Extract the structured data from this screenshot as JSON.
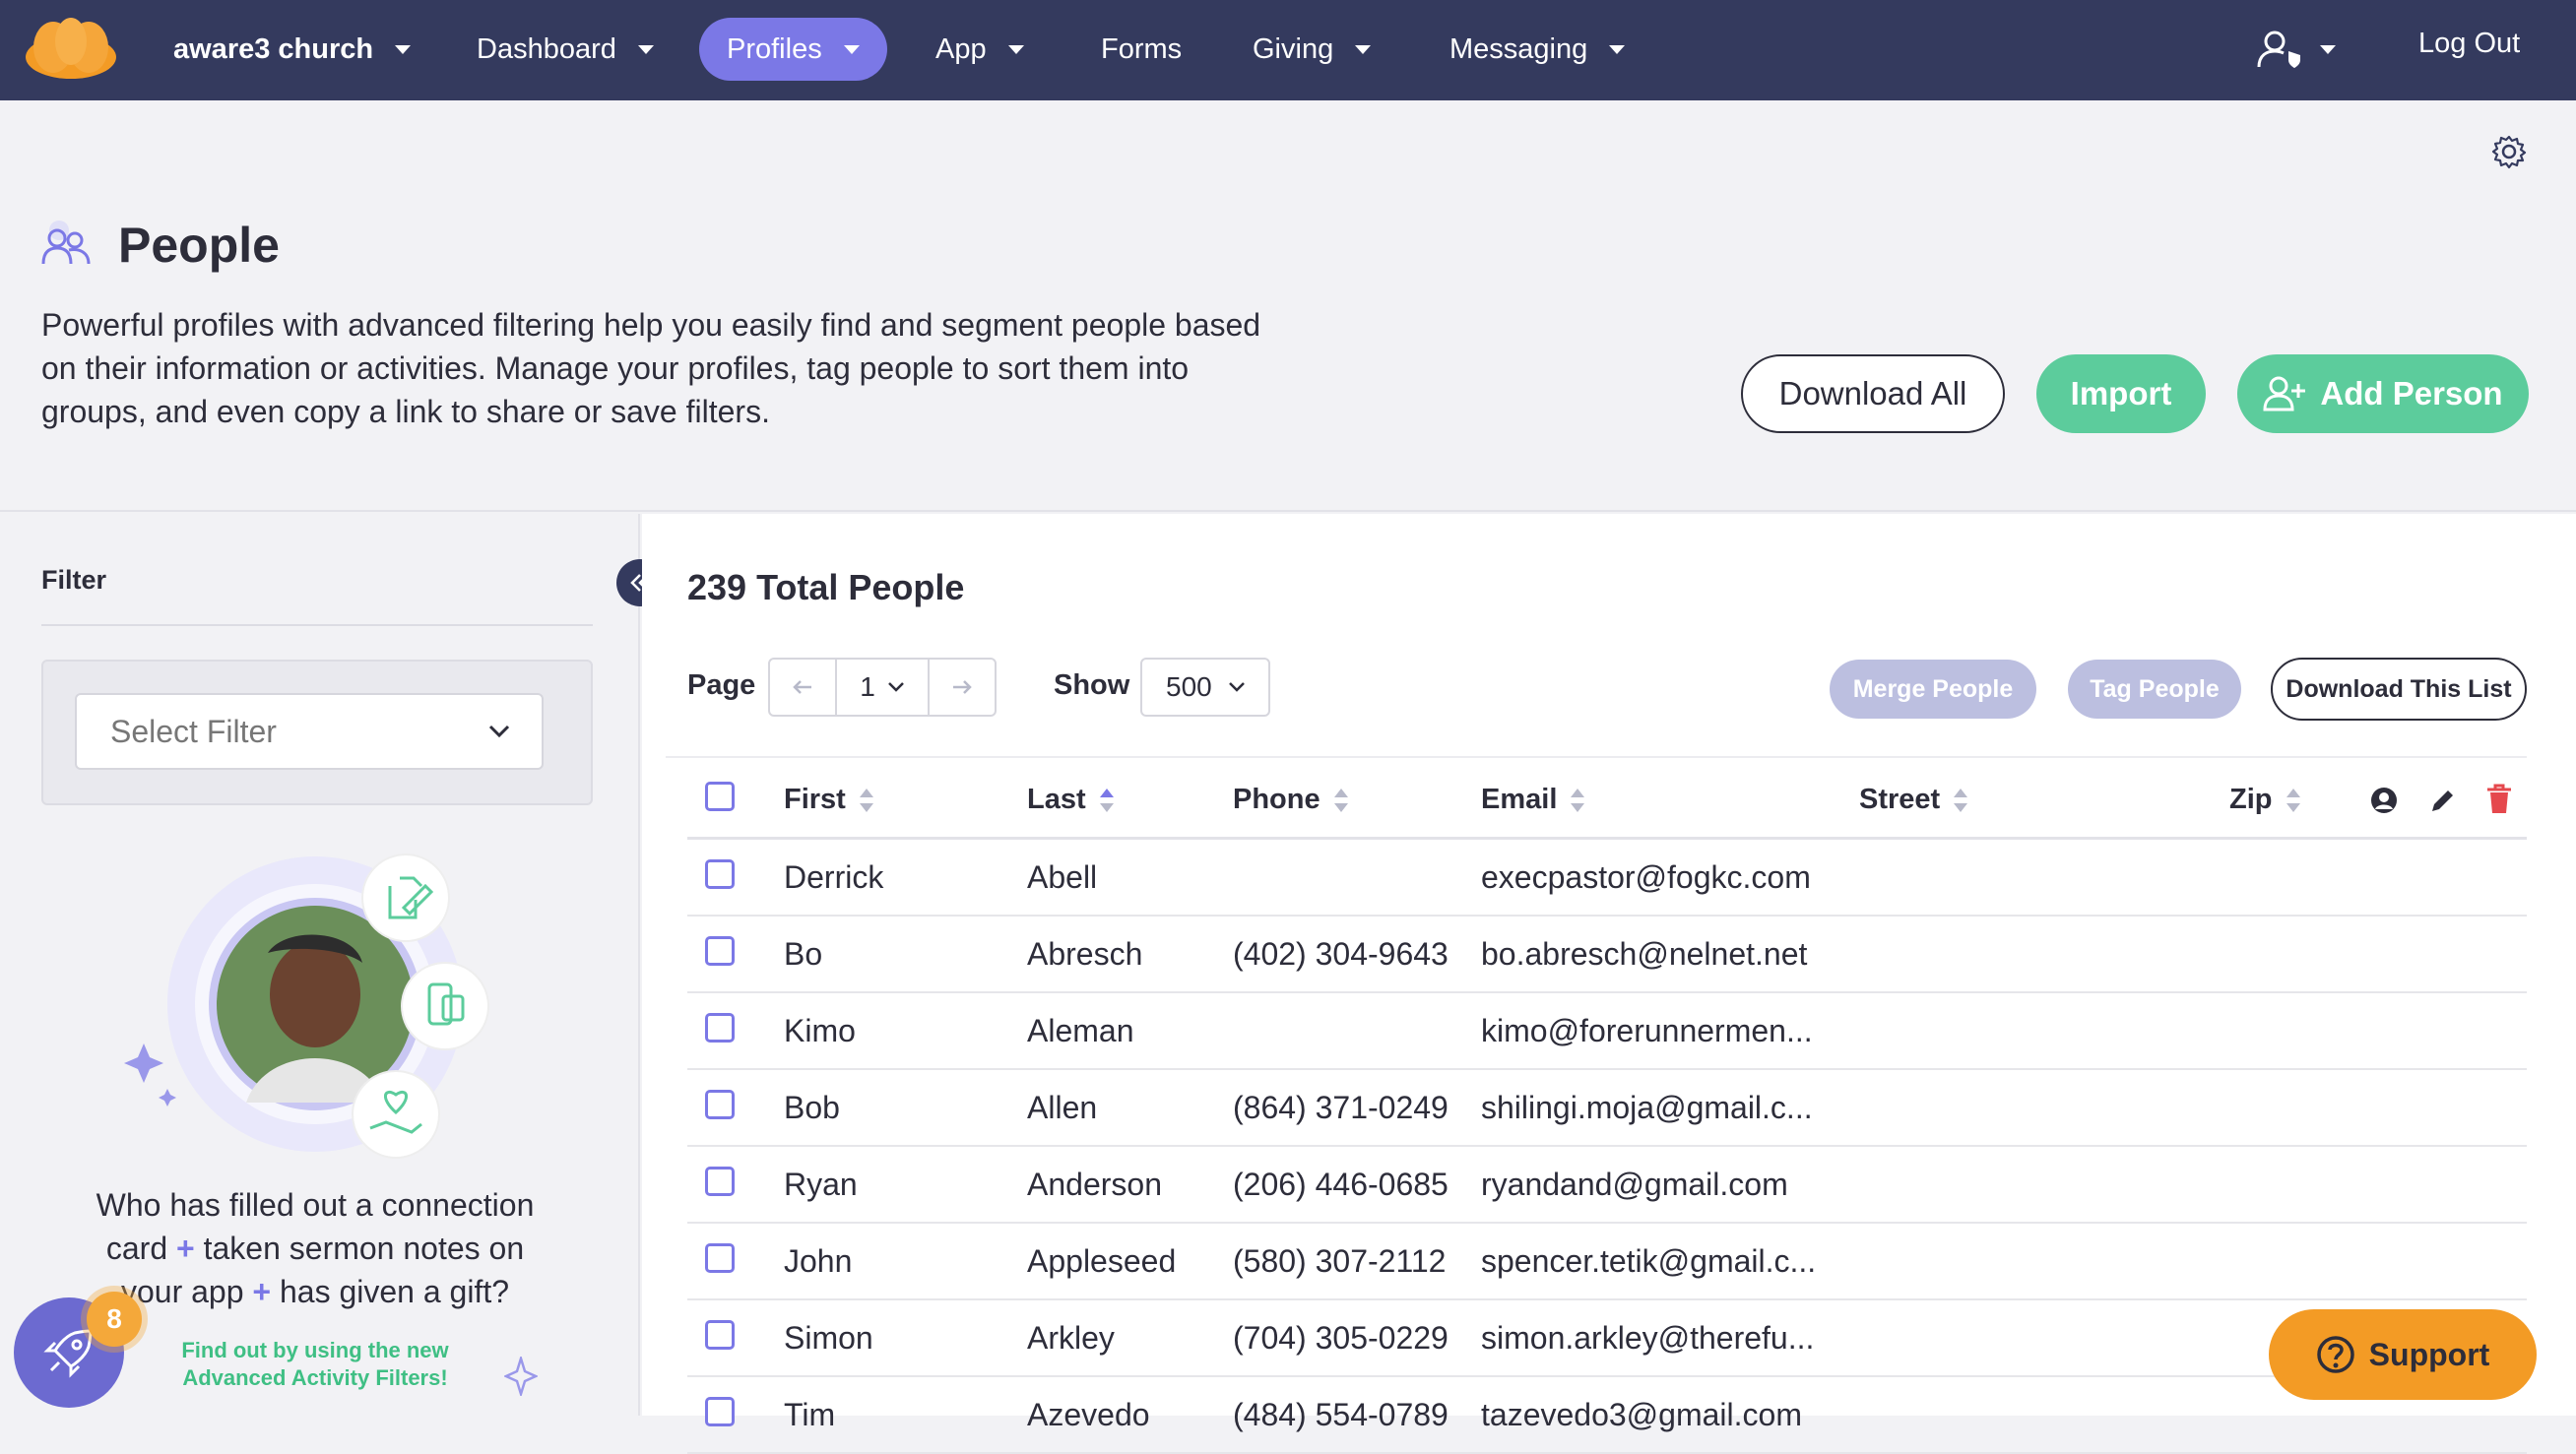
{
  "nav": {
    "org": "aware3 church",
    "items": [
      "Dashboard",
      "Profiles",
      "App",
      "Forms",
      "Giving",
      "Messaging"
    ],
    "logout": "Log Out"
  },
  "header": {
    "title": "People",
    "description": "Powerful profiles with advanced filtering help you easily find and segment people based on their information or activities. Manage your profiles, tag people to sort them into groups, and even copy a link to share or save filters.",
    "download_all": "Download All",
    "import": "Import",
    "add_person": "Add Person"
  },
  "sidebar": {
    "filter_label": "Filter",
    "select_placeholder": "Select Filter",
    "promo_line1": "Who has filled out a connection",
    "promo_line2a": "card",
    "promo_line2b": "taken sermon notes on",
    "promo_line3a": "your app",
    "promo_line3b": "has given a gift?",
    "plus": "+",
    "promo_link": "Find out by using the new Advanced Activity Filters!",
    "rocket_badge": "8"
  },
  "main": {
    "total": "239 Total People",
    "page_label": "Page",
    "page_value": "1",
    "show_label": "Show",
    "show_value": "500",
    "merge": "Merge People",
    "tag": "Tag People",
    "download_list": "Download This List",
    "columns": [
      "First",
      "Last",
      "Phone",
      "Email",
      "Street",
      "Zip"
    ],
    "rows": [
      [
        "Derrick",
        "Abell",
        "",
        "execpastor@fogkc.com"
      ],
      [
        "Bo",
        "Abresch",
        "(402) 304-9643",
        "bo.abresch@nelnet.net"
      ],
      [
        "Kimo",
        "Aleman",
        "",
        "kimo@forerunnermen..."
      ],
      [
        "Bob",
        "Allen",
        "(864) 371-0249",
        "shilingi.moja@gmail.c..."
      ],
      [
        "Ryan",
        "Anderson",
        "(206) 446-0685",
        "ryandand@gmail.com"
      ],
      [
        "John",
        "Appleseed",
        "(580) 307-2112",
        "spencer.tetik@gmail.c..."
      ],
      [
        "Simon",
        "Arkley",
        "(704) 305-0229",
        "simon.arkley@therefu..."
      ],
      [
        "Tim",
        "Azevedo",
        "(484) 554-0789",
        "tazevedo3@gmail.com"
      ]
    ]
  },
  "support": "Support",
  "colors": {
    "nav": "#343a5e",
    "accent": "#7b78e6",
    "green": "#5ccc9c",
    "support": "#f39b25"
  }
}
